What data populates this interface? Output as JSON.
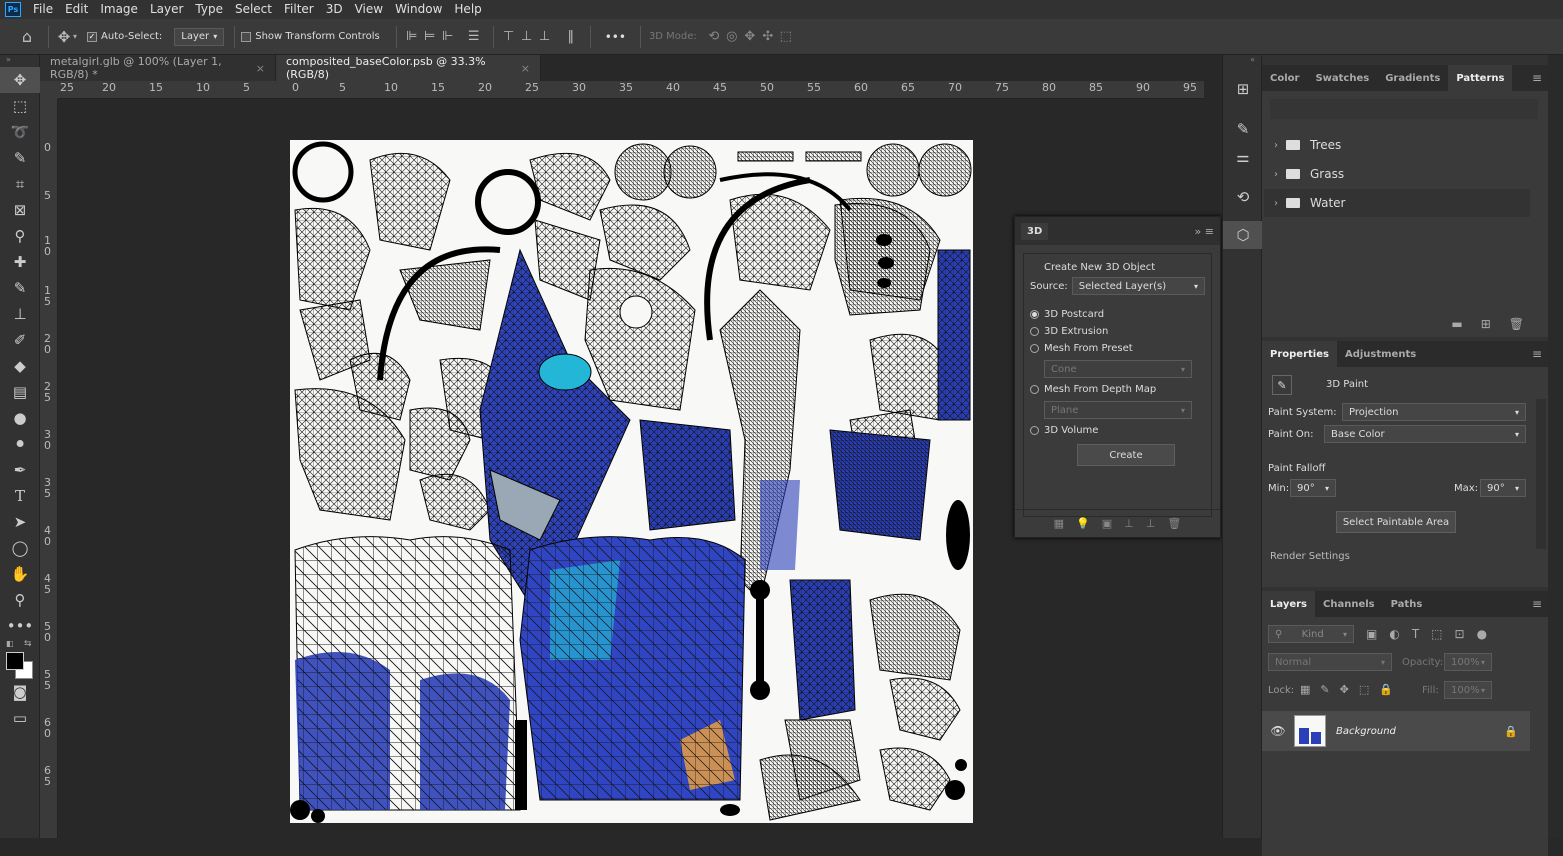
{
  "menubar": {
    "logo": "Ps",
    "items": [
      "File",
      "Edit",
      "Image",
      "Layer",
      "Type",
      "Select",
      "Filter",
      "3D",
      "View",
      "Window",
      "Help"
    ]
  },
  "options": {
    "auto_select_label": "Auto-Select:",
    "auto_select_value": "Layer",
    "show_transform_label": "Show Transform Controls",
    "mode_3d_label": "3D Mode:",
    "more": "•••"
  },
  "tabs": [
    {
      "label": "metalgirl.glb @ 100% (Layer 1, RGB/8) *"
    },
    {
      "label": "composited_baseColor.psb @ 33.3% (RGB/8)"
    }
  ],
  "ruler": {
    "h": [
      "25",
      "20",
      "15",
      "10",
      "5",
      "0",
      "5",
      "10",
      "15",
      "20",
      "25",
      "30",
      "35",
      "40",
      "45",
      "50",
      "55",
      "60",
      "65",
      "70",
      "75",
      "80",
      "85",
      "90",
      "95"
    ],
    "v": [
      "0",
      "5",
      "1 0",
      "1 5",
      "2 0",
      "2 5",
      "3 0",
      "3 5",
      "4 0",
      "4 5",
      "5 0",
      "5 5",
      "6 0",
      "6 5"
    ]
  },
  "panel3d": {
    "tab": "3D",
    "heading": "Create New 3D Object",
    "source_label": "Source:",
    "source_value": "Selected Layer(s)",
    "opt_postcard": "3D Postcard",
    "opt_extrusion": "3D Extrusion",
    "opt_mesh_preset": "Mesh From Preset",
    "preset_value": "Cone",
    "opt_depth_map": "Mesh From Depth Map",
    "depth_value": "Plane",
    "opt_volume": "3D Volume",
    "create": "Create"
  },
  "patterns": {
    "tabs": [
      "Color",
      "Swatches",
      "Gradients",
      "Patterns"
    ],
    "folders": [
      "Trees",
      "Grass",
      "Water"
    ]
  },
  "properties": {
    "tabs": [
      "Properties",
      "Adjustments"
    ],
    "title": "3D Paint",
    "paint_system_label": "Paint System:",
    "paint_system_value": "Projection",
    "paint_on_label": "Paint On:",
    "paint_on_value": "Base Color",
    "falloff_label": "Paint Falloff",
    "min_label": "Min:",
    "min_value": "90°",
    "max_label": "Max:",
    "max_value": "90°",
    "select_area": "Select Paintable Area",
    "render_settings": "Render Settings"
  },
  "layers": {
    "tabs": [
      "Layers",
      "Channels",
      "Paths"
    ],
    "kind": "Kind",
    "blend": "Normal",
    "opacity_label": "Opacity:",
    "opacity_value": "100%",
    "lock_label": "Lock:",
    "fill_label": "Fill:",
    "fill_value": "100%",
    "layer_name": "Background"
  }
}
